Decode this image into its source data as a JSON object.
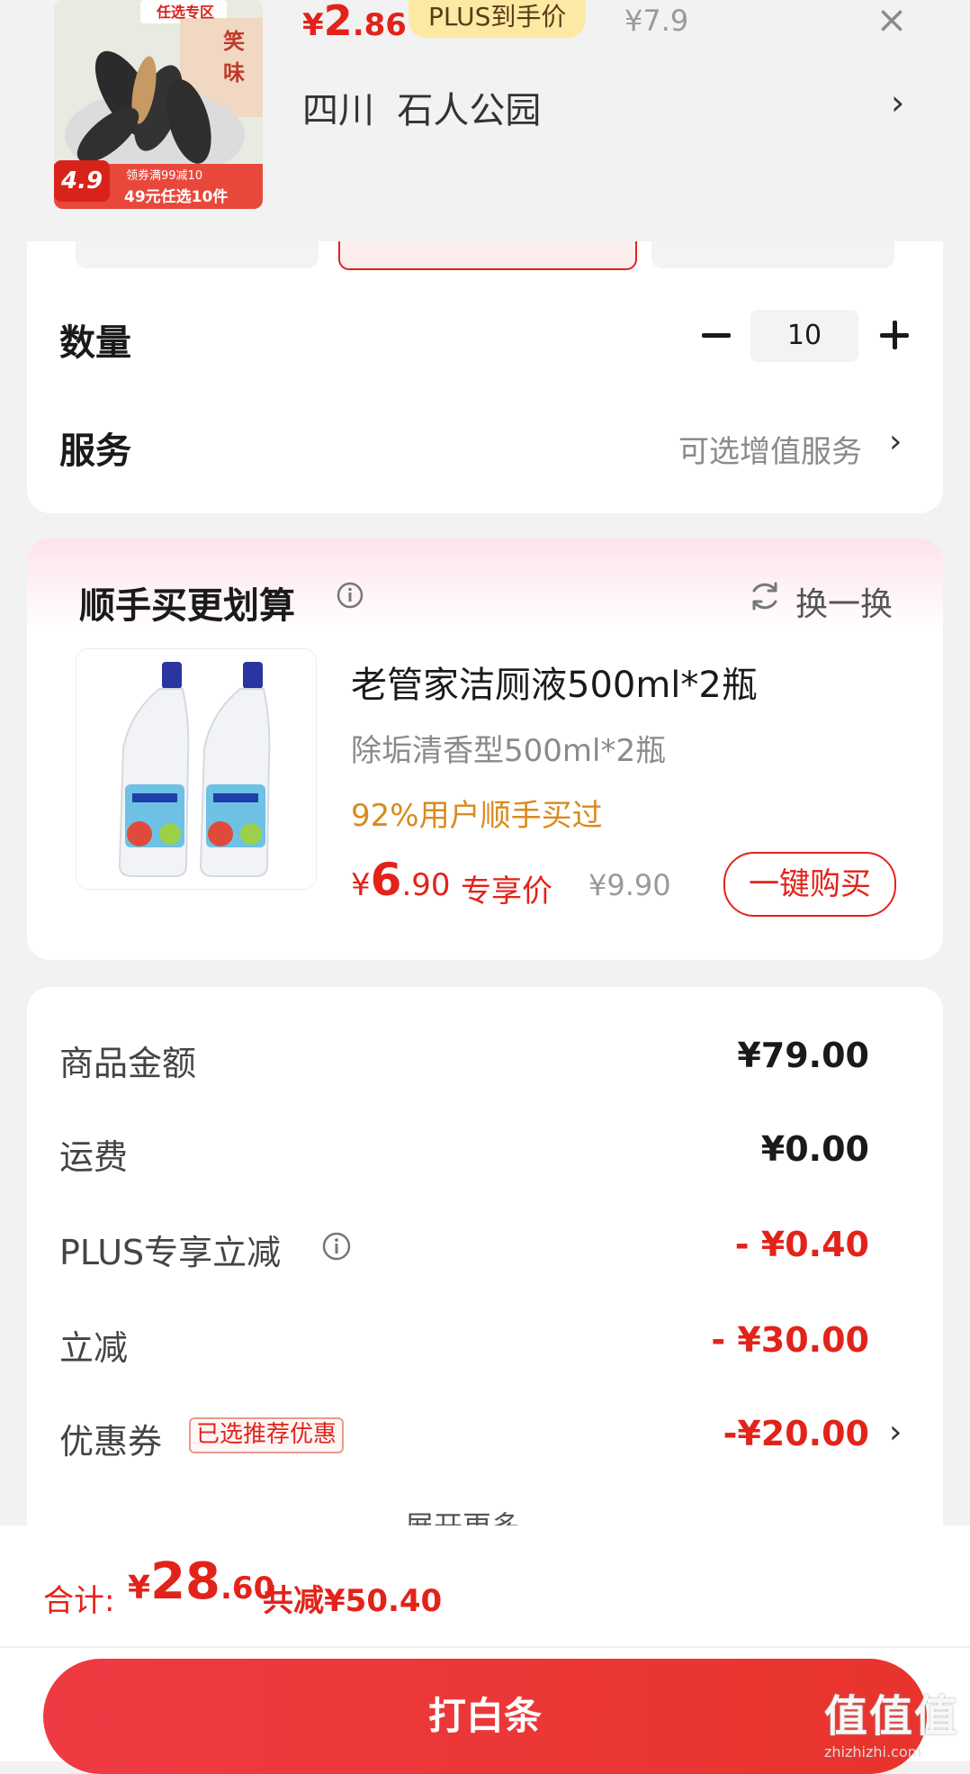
{
  "header": {
    "price_currency": "¥",
    "price_int": "2",
    "price_dec": ".86",
    "plus_tag": "PLUS到手价",
    "original_price": "¥7.9",
    "close_icon": "×",
    "location": "四川  石人公园",
    "location_chevron": "›",
    "thumb": {
      "top_tag": "任选专区",
      "side_text": "笑味",
      "rating": "4.9",
      "coupon_text": "领券满99减10",
      "promo_text": "49元任选10件"
    }
  },
  "options": {
    "quantity_label": "数量",
    "quantity_value": "10",
    "service_label": "服务",
    "service_value": "可选增值服务",
    "chevron": "›"
  },
  "bundle": {
    "title": "顺手买更划算",
    "swap_label": "换一换",
    "product": {
      "name": "老管家洁厕液500ml*2瓶",
      "spec": "除垢清香型500ml*2瓶",
      "social_proof": "92%用户顺手买过",
      "price_currency": "¥",
      "price_int": "6",
      "price_dec": ".90",
      "price_label": "专享价",
      "original_price": "¥9.90",
      "buy_label": "一键购买"
    }
  },
  "summary": {
    "rows": [
      {
        "label": "商品金额",
        "value": "¥79.00"
      },
      {
        "label": "运费",
        "value": "¥0.00"
      },
      {
        "label": "PLUS专享立减",
        "value": "- ¥0.40"
      },
      {
        "label": "立减",
        "value": "- ¥30.00"
      },
      {
        "label": "优惠券",
        "value": "-¥20.00"
      }
    ],
    "coupon_badge": "已选推荐优惠",
    "expand_more": "展开更多 ⌄"
  },
  "footer": {
    "total_label": "合计:",
    "total_currency": "¥",
    "total_int": "28",
    "total_dec": ".60",
    "saved": "共减¥50.40",
    "submit_label": "打白条"
  },
  "watermark": {
    "text": "值值值",
    "domain": "zhizhizhi.com"
  },
  "colors": {
    "accent": "#e2231a",
    "plus_tag_bg": "#fce9a3",
    "social_proof": "#d98a1f"
  },
  "icons": [
    "close-icon",
    "chevron-right-icon",
    "minus-icon",
    "plus-icon",
    "info-icon",
    "refresh-icon",
    "chevron-down-icon"
  ]
}
